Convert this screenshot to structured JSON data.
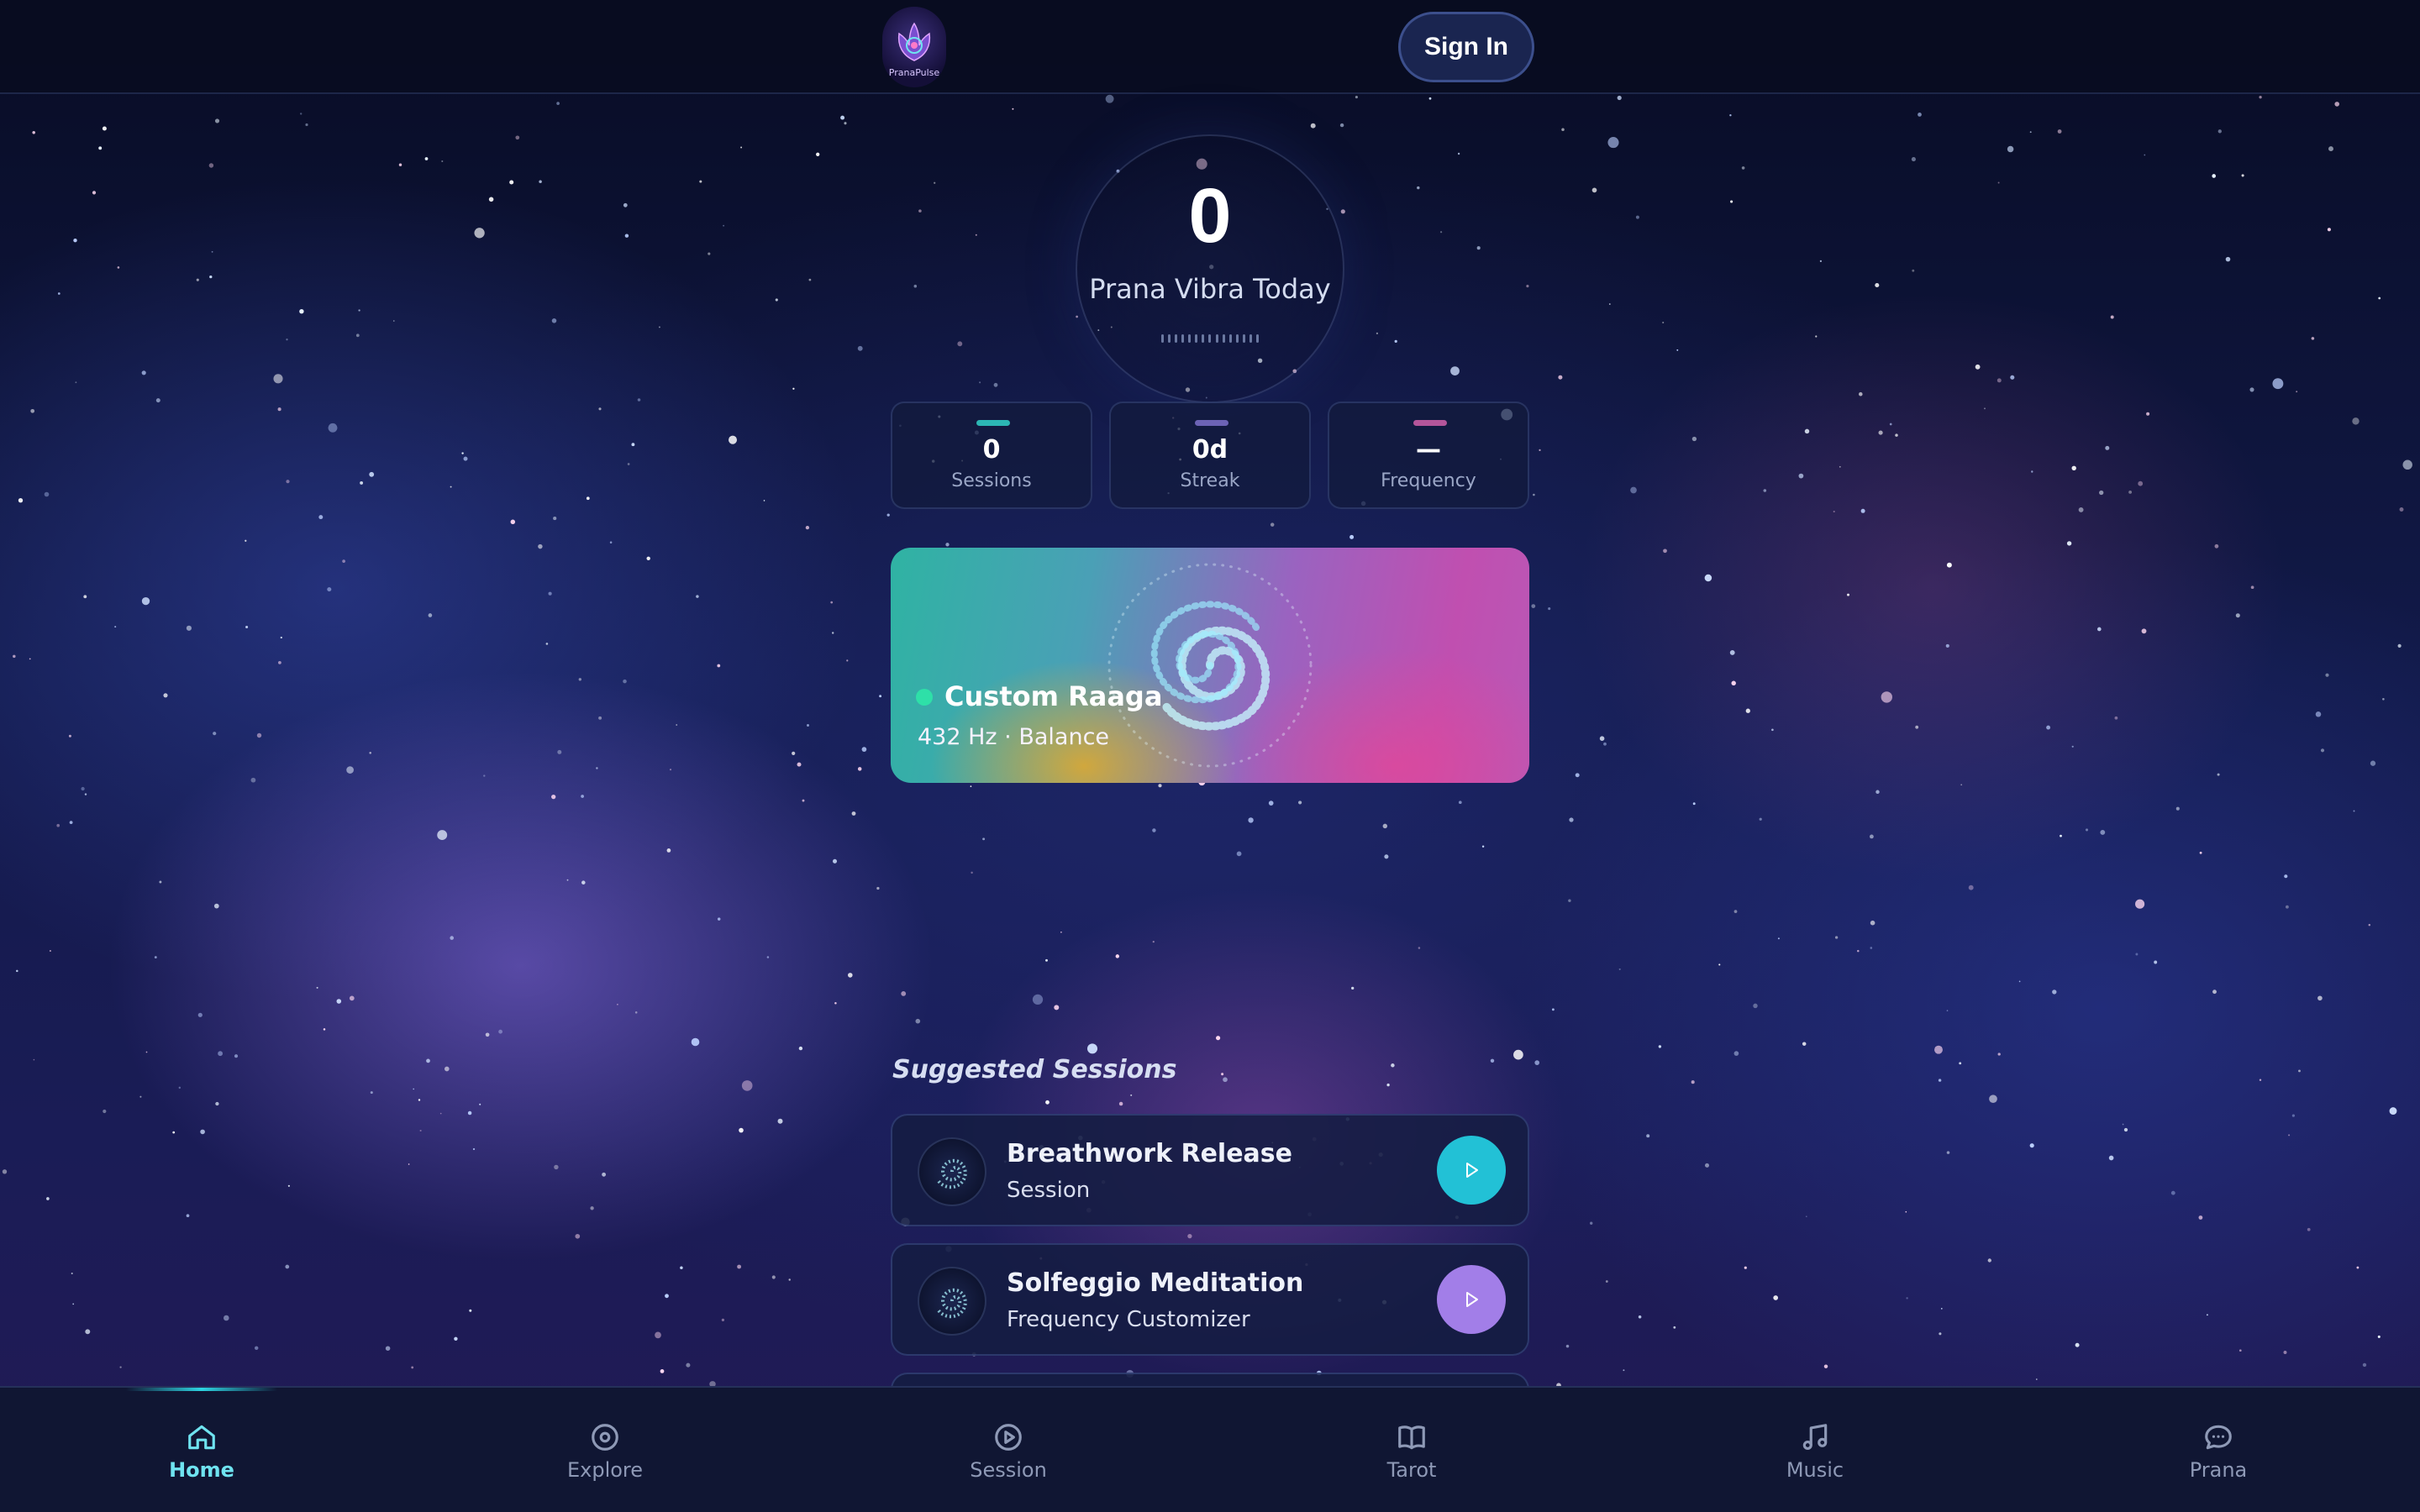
{
  "header": {
    "logo_text": "PranaPulse",
    "signin_label": "Sign In"
  },
  "score": {
    "value": "0",
    "label": "Prana Vibra Today"
  },
  "stats": [
    {
      "value": "0",
      "label": "Sessions",
      "accent": "#2cb6b4"
    },
    {
      "value": "0d",
      "label": "Streak",
      "accent": "#6c63b5"
    },
    {
      "value": "—",
      "label": "Frequency",
      "accent": "#b4559a"
    }
  ],
  "featured": {
    "title": "Custom Raaga",
    "subtitle": "432 Hz · Balance",
    "status_color": "#2ee0a8"
  },
  "suggested": {
    "title": "Suggested Sessions",
    "items": [
      {
        "name": "Breathwork Release",
        "meta": "Session",
        "button_color": "#22c1d6"
      },
      {
        "name": "Solfeggio Meditation",
        "meta": "Frequency Customizer",
        "button_color": "#a27ee8"
      }
    ]
  },
  "nav": {
    "items": [
      {
        "label": "Home",
        "icon": "home-icon",
        "active": true
      },
      {
        "label": "Explore",
        "icon": "compass-icon",
        "active": false
      },
      {
        "label": "Session",
        "icon": "play-circle-icon",
        "active": false
      },
      {
        "label": "Tarot",
        "icon": "book-icon",
        "active": false
      },
      {
        "label": "Music",
        "icon": "music-icon",
        "active": false
      },
      {
        "label": "Prana",
        "icon": "chat-icon",
        "active": false
      }
    ]
  }
}
